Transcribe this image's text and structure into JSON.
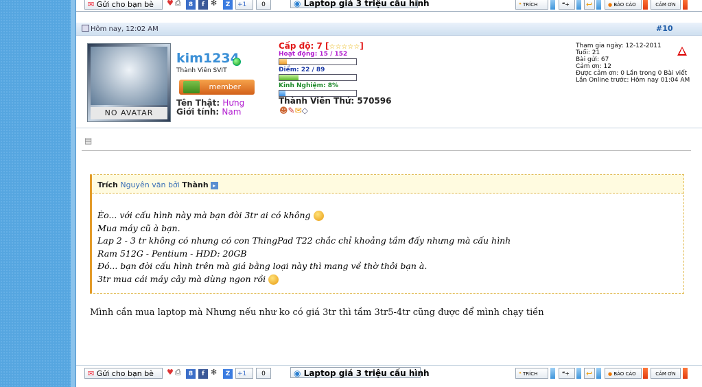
{
  "toolbar": {
    "send_label": "Gửi cho bạn bè",
    "count": "0",
    "title_label": "Laptop giá 3 triệu cấu hình",
    "quote_label": "TRÍCH",
    "report_label": "BÁO CÁO",
    "thanks_label": "CẢM ƠN",
    "plus_label": "+1"
  },
  "post": {
    "date": "Hôm nay, 12:02 AM",
    "number": "#10",
    "user": {
      "name": "kim1234",
      "title": "Thành Viên SVIT",
      "rank_label": "member",
      "avatar_label": "NO AVATAR",
      "real_name_label": "Tên Thật:",
      "real_name": "Hưng",
      "gender_label": "Giới tính:",
      "gender": "Nam"
    },
    "stats": {
      "level": "Cấp độ: 7 [",
      "level_stars": "☆☆☆☆☆",
      "level_end": "]",
      "activity": "Hoạt động: 15 / 152",
      "activity_fraction": 0.1,
      "points": "Điểm: 22 / 89",
      "points_fraction": 0.25,
      "experience": "Kinh Nghiệm: 8%",
      "experience_fraction": 0.08,
      "member_number": "Thành Viên Thứ: 570596"
    },
    "right_info": [
      "Tham gia ngày: 12-12-2011",
      "Tuổi: 21",
      "Bài gửi: 67",
      "Cảm ơn: 12",
      "Được cảm ơn: 0 Lần trong 0 Bài viết",
      "Lần Online trước: Hôm nay 01:04 AM"
    ],
    "quote": {
      "prefix": "Trích",
      "source": "Nguyên văn bởi",
      "author": "Thành",
      "lines": [
        "Èo... với cấu hình này mà bạn đòi 3tr ai có không",
        "Mua máy cũ à bạn.",
        "Lap 2 - 3 tr không có nhưng có con ThingPad T22 chắc chỉ khoảng tầm đấy nhưng mà cấu hình",
        "Ram 512G - Pentium - HDD: 20GB",
        "Đó... bạn đòi cấu hình trên mà giá bằng loại này thì mang về thờ thôi bạn à.",
        "3tr mua cái máy cây mà dùng ngon rồi"
      ]
    },
    "message": "Mình cần mua laptop mà Nhưng nếu như ko có giá 3tr thì tầm 3tr5-4tr cũng được để mình chạy tiền"
  }
}
